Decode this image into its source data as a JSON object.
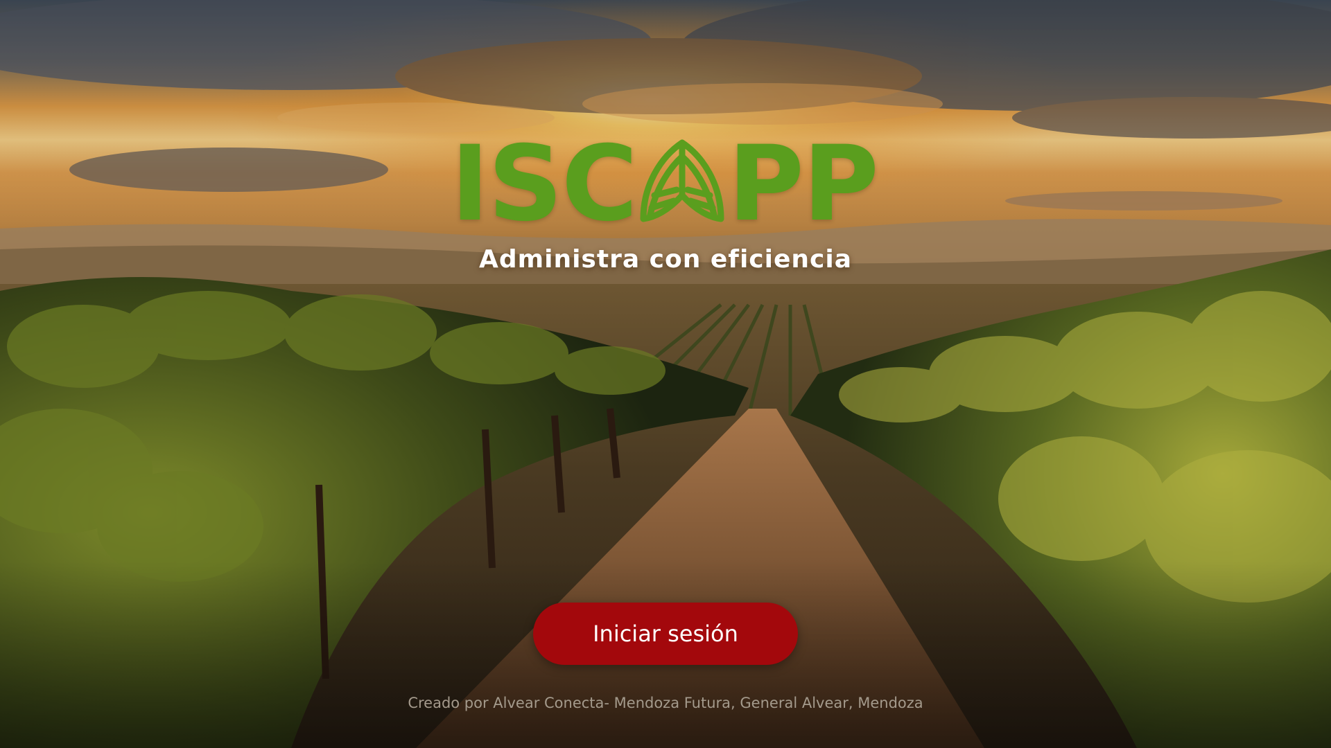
{
  "app": {
    "logo_text_left": "ISC",
    "logo_text_right": "PP",
    "tagline": "Administra con eficiencia",
    "brand_color": "#5a9e1e"
  },
  "actions": {
    "login_label": "Iniciar sesión",
    "login_color": "#a3080c"
  },
  "footer": {
    "credit": "Creado por Alvear Conecta- Mendoza Futura, General Alvear, Mendoza"
  },
  "background": {
    "scene": "vineyard-sunset"
  }
}
